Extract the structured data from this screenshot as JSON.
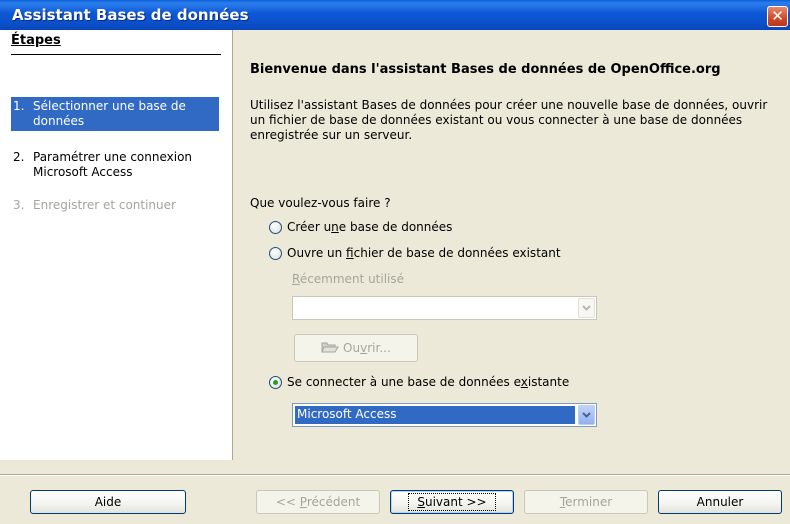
{
  "window": {
    "title": "Assistant Bases de données",
    "close_glyph": "✕"
  },
  "steps": {
    "heading": "Étapes",
    "items": [
      {
        "num": "1.",
        "label": "Sélectionner une base de données",
        "state": "active"
      },
      {
        "num": "2.",
        "label": "Paramétrer une connexion Microsoft Access",
        "state": "normal"
      },
      {
        "num": "3.",
        "label": "Enregistrer et continuer",
        "state": "disabled"
      }
    ]
  },
  "main": {
    "heading": "Bienvenue dans l'assistant Bases de données de OpenOffice.org",
    "intro": "Utilisez l'assistant Bases de données pour créer une nouvelle base de données, ouvrir un fichier de base de données existant ou vous connecter à une base de données enregistrée sur un serveur.",
    "question": "Que voulez-vous faire ?",
    "option_create": {
      "pre": "Créer u",
      "mn": "n",
      "post": "e base de données",
      "checked": false
    },
    "option_open": {
      "pre": "Ouvre un ",
      "mn": "f",
      "post": "ichier de base de données existant",
      "checked": false
    },
    "recent_label": {
      "pre": "",
      "mn": "R",
      "post": "écemment utilisé"
    },
    "recent_value": "",
    "open_button": {
      "pre": "Ou",
      "mn": "v",
      "post": "rir...",
      "icon": "folder-open-icon"
    },
    "option_connect": {
      "pre": "Se connecter à une base de données e",
      "mn": "x",
      "post": "istante",
      "checked": true
    },
    "connect_type": "Microsoft Access"
  },
  "footer": {
    "help": "Aide",
    "previous": {
      "pre": "<< ",
      "mn": "P",
      "post": "récédent"
    },
    "next": {
      "pre": "",
      "mn": "S",
      "post": "uivant >>"
    },
    "finish": {
      "pre": "",
      "mn": "T",
      "post": "erminer"
    },
    "cancel": "Annuler"
  },
  "colors": {
    "titlebar": "#0A5FD9",
    "selection": "#316AC5",
    "background": "#ECE9D8"
  }
}
